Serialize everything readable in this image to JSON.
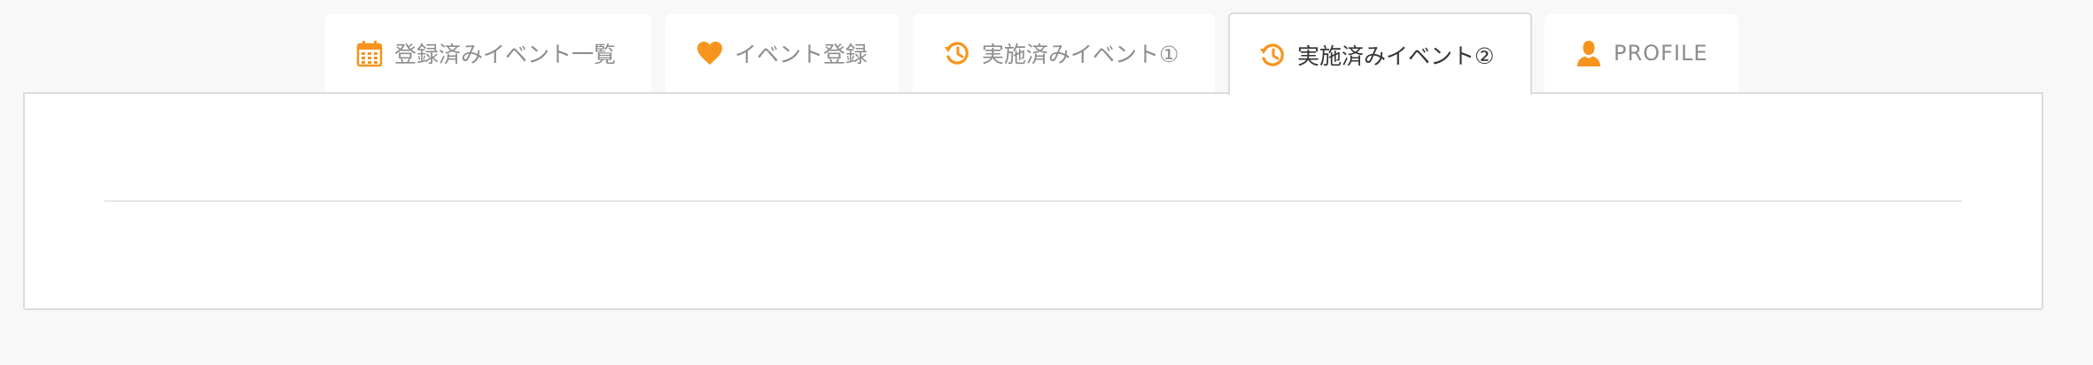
{
  "accent_color": "#f7941d",
  "tabs": [
    {
      "label": "登録済みイベント一覧",
      "icon": "calendar-icon",
      "active": false
    },
    {
      "label": "イベント登録",
      "icon": "heart-icon",
      "active": false
    },
    {
      "label": "実施済みイベント①",
      "icon": "history-icon",
      "active": false
    },
    {
      "label": "実施済みイベント②",
      "icon": "history-icon",
      "active": true
    },
    {
      "label": "PROFILE",
      "icon": "user-icon",
      "active": false
    }
  ]
}
